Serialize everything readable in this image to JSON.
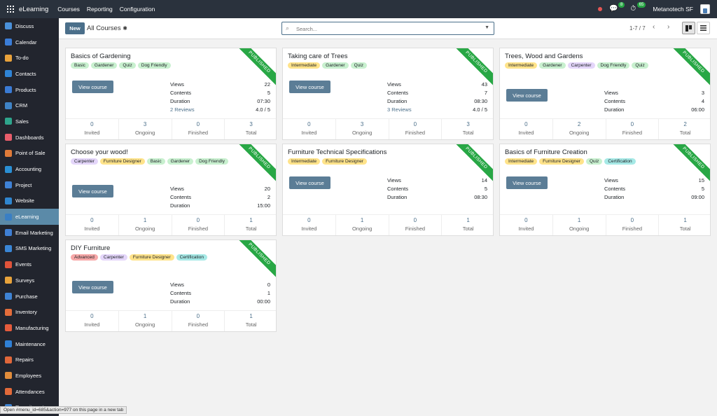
{
  "topbar": {
    "brand": "eLearning",
    "menus": [
      "Courses",
      "Reporting",
      "Configuration"
    ],
    "messages_count": "8",
    "activities_count": "65",
    "company": "Metanotech SF"
  },
  "sidebar": {
    "items": [
      {
        "label": "Discuss",
        "color": "#4a90d9"
      },
      {
        "label": "Calendar",
        "color": "#3b7dd8"
      },
      {
        "label": "To-do",
        "color": "#e9a23b"
      },
      {
        "label": "Contacts",
        "color": "#2f84d6"
      },
      {
        "label": "Products",
        "color": "#3a7bd5"
      },
      {
        "label": "CRM",
        "color": "#3f83c6"
      },
      {
        "label": "Sales",
        "color": "#2ea58c"
      },
      {
        "label": "Dashboards",
        "color": "#e85d6b"
      },
      {
        "label": "Point of Sale",
        "color": "#e07b39"
      },
      {
        "label": "Accounting",
        "color": "#2a8fd4"
      },
      {
        "label": "Project",
        "color": "#3f82d6"
      },
      {
        "label": "Website",
        "color": "#2f86d0"
      },
      {
        "label": "eLearning",
        "color": "#3a7fc4"
      },
      {
        "label": "Email Marketing",
        "color": "#3f7fd4"
      },
      {
        "label": "SMS Marketing",
        "color": "#3a86d6"
      },
      {
        "label": "Events",
        "color": "#e0533a"
      },
      {
        "label": "Surveys",
        "color": "#e8a33b"
      },
      {
        "label": "Purchase",
        "color": "#3e83d4"
      },
      {
        "label": "Inventory",
        "color": "#e46d3b"
      },
      {
        "label": "Manufacturing",
        "color": "#e55b3c"
      },
      {
        "label": "Maintenance",
        "color": "#2f80d6"
      },
      {
        "label": "Repairs",
        "color": "#e0673a"
      },
      {
        "label": "Employees",
        "color": "#e28d3b"
      },
      {
        "label": "Attendances",
        "color": "#e26a3a"
      },
      {
        "label": "Recruitment",
        "color": "#3a80d0"
      }
    ],
    "active_label": "eLearning"
  },
  "control": {
    "new_label": "New",
    "breadcrumb": "All Courses",
    "search_placeholder": "Search...",
    "pager": "1-7 / 7"
  },
  "card_labels": {
    "published": "PUBLISHED",
    "view_course": "View course",
    "views": "Views",
    "contents": "Contents",
    "duration": "Duration",
    "invited": "Invited",
    "ongoing": "Ongoing",
    "finished": "Finished",
    "total": "Total"
  },
  "tag_colors": {
    "Basic": "#c8f0cf",
    "Gardener": "#c8f0cf",
    "Quiz": "#c8f0cf",
    "Dog Friendly": "#c8f0cf",
    "Intermediate": "#ffe38a",
    "Carpenter": "#e4d6fa",
    "Furniture Designer": "#ffe38a",
    "Certification": "#a6e9e6",
    "Advanced": "#f7a8a8"
  },
  "courses": [
    {
      "title": "Basics of Gardening",
      "tags": [
        "Basic",
        "Gardener",
        "Quiz",
        "Dog Friendly"
      ],
      "views": "22",
      "contents": "5",
      "duration": "07:30",
      "reviews": "2 Reviews",
      "rating": "4.0 / 5",
      "invited": "0",
      "ongoing": "3",
      "finished": "0",
      "total": "3"
    },
    {
      "title": "Taking care of Trees",
      "tags": [
        "Intermediate",
        "Gardener",
        "Quiz"
      ],
      "views": "43",
      "contents": "7",
      "duration": "08:30",
      "reviews": "3 Reviews",
      "rating": "4.0 / 5",
      "invited": "0",
      "ongoing": "3",
      "finished": "0",
      "total": "3"
    },
    {
      "title": "Trees, Wood and Gardens",
      "tags": [
        "Intermediate",
        "Gardener",
        "Carpenter",
        "Dog Friendly",
        "Quiz"
      ],
      "views": "3",
      "contents": "4",
      "duration": "06:00",
      "reviews": "",
      "rating": "",
      "invited": "0",
      "ongoing": "2",
      "finished": "0",
      "total": "2"
    },
    {
      "title": "Choose your wood!",
      "tags": [
        "Carpenter",
        "Furniture Designer",
        "Basic",
        "Gardener",
        "Dog Friendly"
      ],
      "views": "20",
      "contents": "2",
      "duration": "15:00",
      "reviews": "",
      "rating": "",
      "invited": "0",
      "ongoing": "1",
      "finished": "0",
      "total": "1"
    },
    {
      "title": "Furniture Technical Specifications",
      "tags": [
        "Intermediate",
        "Furniture Designer"
      ],
      "views": "14",
      "contents": "5",
      "duration": "08:30",
      "reviews": "",
      "rating": "",
      "invited": "0",
      "ongoing": "1",
      "finished": "0",
      "total": "1"
    },
    {
      "title": "Basics of Furniture Creation",
      "tags": [
        "Intermediate",
        "Furniture Designer",
        "Quiz",
        "Certification"
      ],
      "views": "15",
      "contents": "5",
      "duration": "09:00",
      "reviews": "",
      "rating": "",
      "invited": "0",
      "ongoing": "1",
      "finished": "0",
      "total": "1"
    },
    {
      "title": "DIY Furniture",
      "tags": [
        "Advanced",
        "Carpenter",
        "Furniture Designer",
        "Certification"
      ],
      "views": "0",
      "contents": "1",
      "duration": "00:00",
      "reviews": "",
      "rating": "",
      "invited": "0",
      "ongoing": "1",
      "finished": "0",
      "total": "1"
    }
  ],
  "statusbar": "Open #menu_id=685&action=977 on this page in a new tab"
}
